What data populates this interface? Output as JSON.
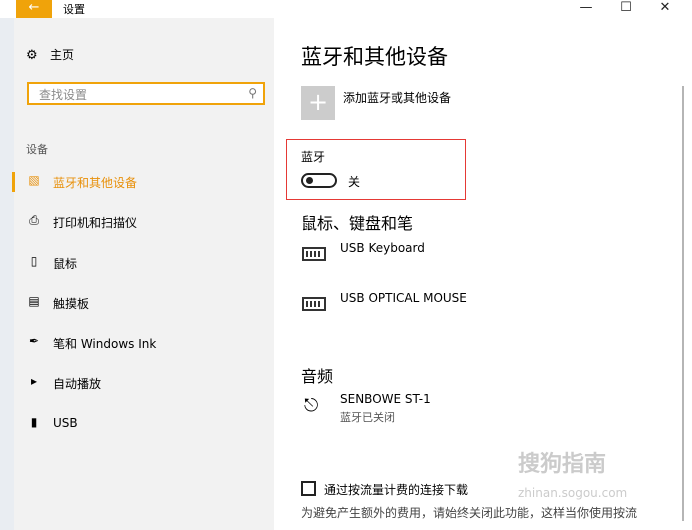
{
  "window": {
    "title": "设置",
    "back_icon": "arrow-left-icon",
    "minimize_icon": "minimize-icon",
    "maximize_icon": "maximize-icon",
    "close_icon": "close-icon",
    "accent_color": "#f0a30a"
  },
  "sidebar": {
    "home_label": "主页",
    "search_placeholder": "查找设置",
    "group_header": "设备",
    "items": [
      {
        "label": "蓝牙和其他设备",
        "icon": "bluetooth-devices-icon",
        "active": true
      },
      {
        "label": "打印机和扫描仪",
        "icon": "printer-icon",
        "active": false
      },
      {
        "label": "鼠标",
        "icon": "mouse-icon",
        "active": false
      },
      {
        "label": "触摸板",
        "icon": "touchpad-icon",
        "active": false
      },
      {
        "label": "笔和 Windows Ink",
        "icon": "pen-icon",
        "active": false
      },
      {
        "label": "自动播放",
        "icon": "autoplay-icon",
        "active": false
      },
      {
        "label": "USB",
        "icon": "usb-icon",
        "active": false
      }
    ]
  },
  "main": {
    "title": "蓝牙和其他设备",
    "add_device_label": "添加蓝牙或其他设备",
    "bluetooth": {
      "label": "蓝牙",
      "state": "关",
      "on": false
    },
    "mouse_section": {
      "title": "鼠标、键盘和笔",
      "devices": [
        "USB Keyboard",
        "USB OPTICAL MOUSE"
      ]
    },
    "audio_section": {
      "title": "音频",
      "device": "SENBOWE ST-1",
      "status": "蓝牙已关闭"
    },
    "metered": {
      "label": "通过按流量计费的连接下载",
      "description": "为避免产生额外的费用，请始终关闭此功能，这样当你使用按流",
      "checked": false
    }
  },
  "watermark": {
    "text": "搜狗指南",
    "sub": "zhinan.sogou.com"
  }
}
